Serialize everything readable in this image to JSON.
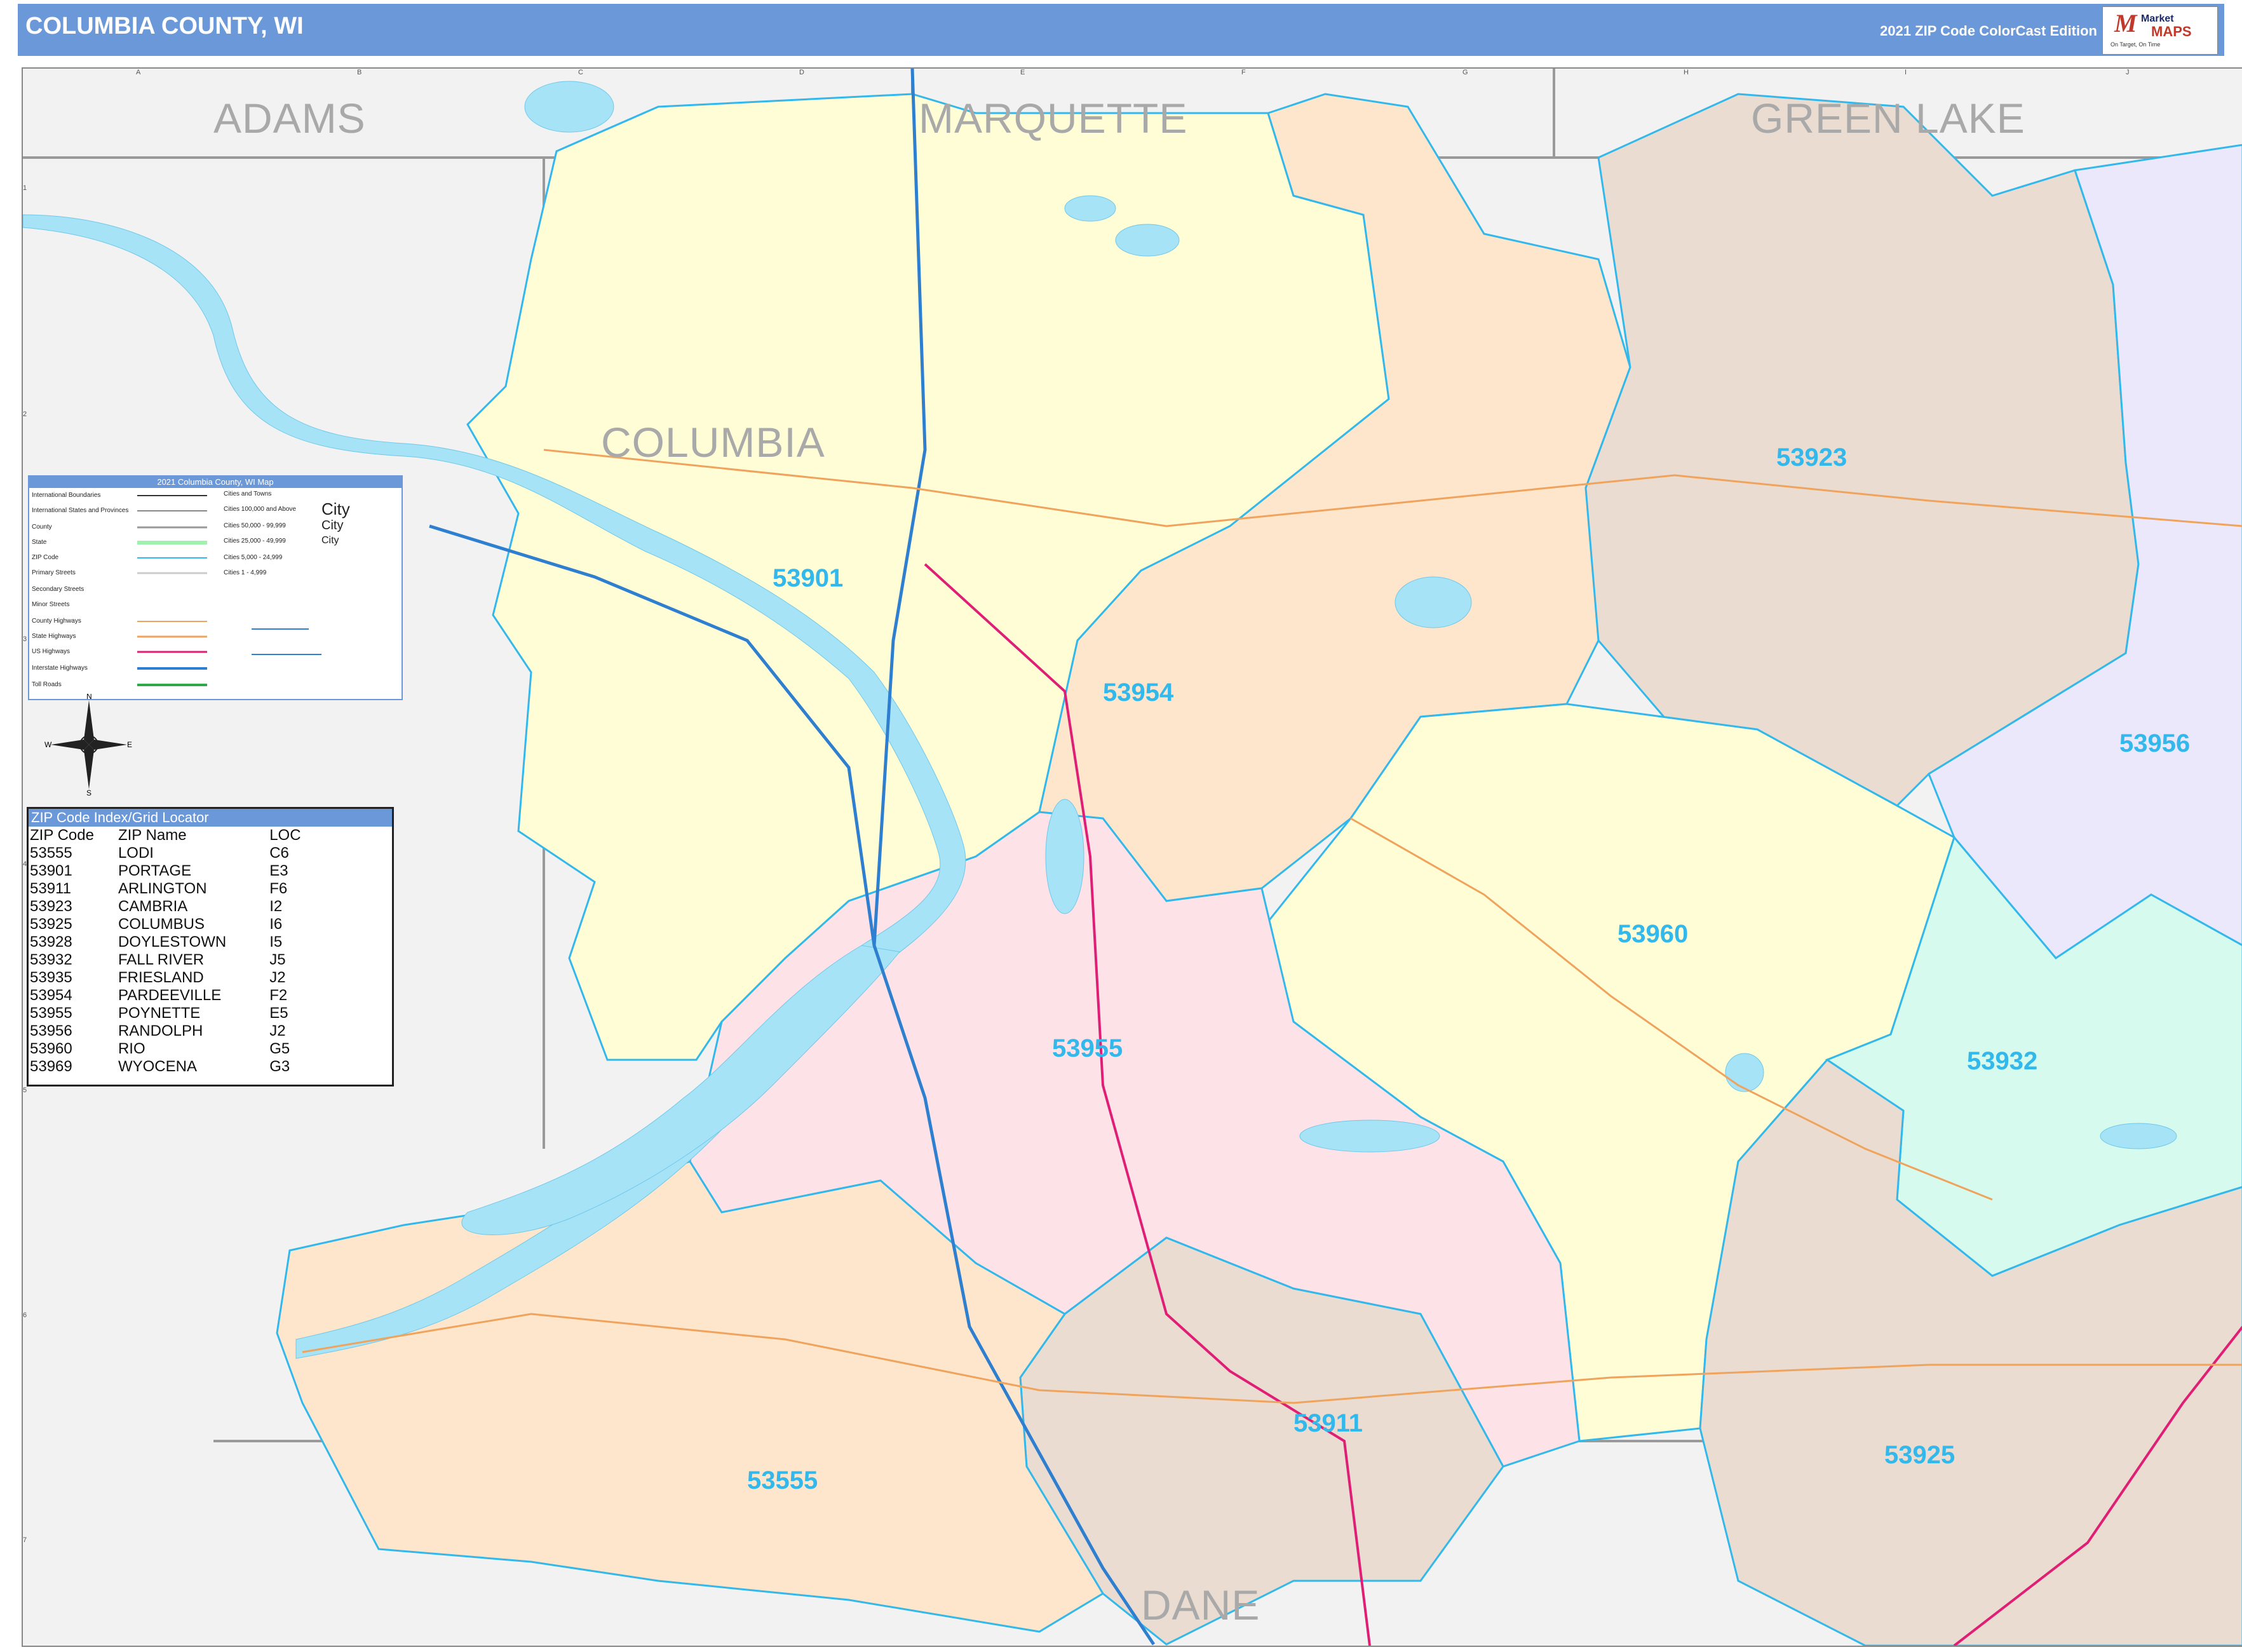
{
  "header": {
    "title": "COLUMBIA COUNTY, WI",
    "edition": "2021 ZIP Code ColorCast Edition"
  },
  "logo": {
    "text_market": "Market",
    "text_maps": "MAPS",
    "tagline": "On Target, On Time"
  },
  "neighbors": {
    "adams": "ADAMS",
    "marquette": "MARQUETTE",
    "green_lake": "GREEN LAKE",
    "dane": "DANE",
    "columbia": "COLUMBIA"
  },
  "zip_labels": {
    "z53901": "53901",
    "z53954": "53954",
    "z53923": "53923",
    "z53956": "53956",
    "z53960": "53960",
    "z53932": "53932",
    "z53955": "53955",
    "z53911": "53911",
    "z53555": "53555",
    "z53925": "53925"
  },
  "legend": {
    "title": "2021 Columbia County, WI Map",
    "rows": [
      "International Boundaries",
      "International States and Provinces",
      "County",
      "State",
      "ZIP Code",
      "Primary Streets",
      "Secondary Streets",
      "Minor Streets",
      "County Highways",
      "State Highways",
      "US Highways",
      "Interstate Highways",
      "Toll Roads"
    ],
    "city_rows": [
      "Cities and Towns",
      "Cities 100,000 and Above",
      "Cities 50,000 - 99,999",
      "Cities 25,000 - 49,999",
      "Cities 5,000 - 24,999",
      "Cities 1 - 4,999"
    ],
    "city_sample": "City"
  },
  "zip_index": {
    "title": "ZIP Code Index/Grid Locator",
    "headers": [
      "ZIP Code",
      "ZIP Name",
      "LOC"
    ],
    "rows": [
      [
        "53555",
        "LODI",
        "C6"
      ],
      [
        "53901",
        "PORTAGE",
        "E3"
      ],
      [
        "53911",
        "ARLINGTON",
        "F6"
      ],
      [
        "53923",
        "CAMBRIA",
        "I2"
      ],
      [
        "53925",
        "COLUMBUS",
        "I6"
      ],
      [
        "53928",
        "DOYLESTOWN",
        "I5"
      ],
      [
        "53932",
        "FALL RIVER",
        "J5"
      ],
      [
        "53935",
        "FRIESLAND",
        "J2"
      ],
      [
        "53954",
        "PARDEEVILLE",
        "F2"
      ],
      [
        "53955",
        "POYNETTE",
        "E5"
      ],
      [
        "53956",
        "RANDOLPH",
        "J2"
      ],
      [
        "53960",
        "RIO",
        "G5"
      ],
      [
        "53969",
        "WYOCENA",
        "G3"
      ]
    ]
  },
  "grid": {
    "top_letters": [
      "A",
      "B",
      "C",
      "D",
      "E",
      "F",
      "G",
      "H",
      "I",
      "J"
    ],
    "side_numbers": [
      "1",
      "2",
      "3",
      "4",
      "5",
      "6",
      "7"
    ]
  },
  "colors": {
    "header": "#6b98d8",
    "zip_label": "#33b8ec",
    "water": "#a6e3f7",
    "zip_yellow": "#fffdd6",
    "zip_orange": "#fde6cc",
    "zip_brown": "#eadcd0",
    "zip_pink": "#fde3e8",
    "zip_purple": "#ece8fb",
    "zip_mint": "#d6fbee"
  }
}
